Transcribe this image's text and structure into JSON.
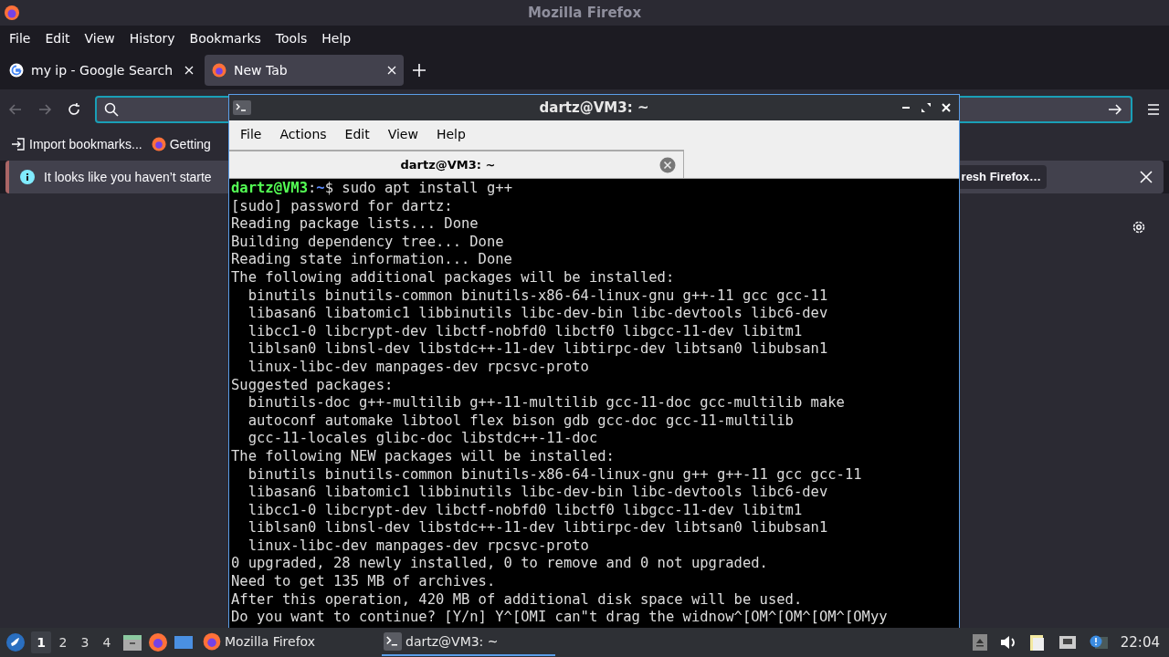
{
  "window": {
    "title": "Mozilla Firefox"
  },
  "menu": [
    "File",
    "Edit",
    "View",
    "History",
    "Bookmarks",
    "Tools",
    "Help"
  ],
  "tabs": [
    {
      "label": "my ip - Google Search",
      "selected": false
    },
    {
      "label": "New Tab",
      "selected": true
    }
  ],
  "bookmarks": [
    "Import bookmarks...",
    "Getting"
  ],
  "notification": {
    "text": "It looks like you haven’t starte",
    "button": "resh Firefox…"
  },
  "terminal": {
    "title": "dartz@VM3: ~",
    "menu": [
      "File",
      "Actions",
      "Edit",
      "View",
      "Help"
    ],
    "tab": "dartz@VM3: ~",
    "prompt": {
      "user": "dartz@VM3",
      "separator": ":",
      "path": "~",
      "command": "$ sudo apt install g++"
    },
    "lines": [
      "[sudo] password for dartz:",
      "Reading package lists... Done",
      "Building dependency tree... Done",
      "Reading state information... Done",
      "The following additional packages will be installed:",
      "  binutils binutils-common binutils-x86-64-linux-gnu g++-11 gcc gcc-11",
      "  libasan6 libatomic1 libbinutils libc-dev-bin libc-devtools libc6-dev",
      "  libcc1-0 libcrypt-dev libctf-nobfd0 libctf0 libgcc-11-dev libitm1",
      "  liblsan0 libnsl-dev libstdc++-11-dev libtirpc-dev libtsan0 libubsan1",
      "  linux-libc-dev manpages-dev rpcsvc-proto",
      "Suggested packages:",
      "  binutils-doc g++-multilib g++-11-multilib gcc-11-doc gcc-multilib make",
      "  autoconf automake libtool flex bison gdb gcc-doc gcc-11-multilib",
      "  gcc-11-locales glibc-doc libstdc++-11-doc",
      "The following NEW packages will be installed:",
      "  binutils binutils-common binutils-x86-64-linux-gnu g++ g++-11 gcc gcc-11",
      "  libasan6 libatomic1 libbinutils libc-dev-bin libc-devtools libc6-dev",
      "  libcc1-0 libcrypt-dev libctf-nobfd0 libctf0 libgcc-11-dev libitm1",
      "  liblsan0 libnsl-dev libstdc++-11-dev libtirpc-dev libtsan0 libubsan1",
      "  linux-libc-dev manpages-dev rpcsvc-proto",
      "0 upgraded, 28 newly installed, 0 to remove and 0 not upgraded.",
      "Need to get 135 MB of archives.",
      "After this operation, 420 MB of additional disk space will be used.",
      "Do you want to continue? [Y/n] Y^[OMI can\"t drag the widnow^[OM^[OM^[OM^[OMyy"
    ]
  },
  "taskbar": {
    "workspaces": [
      {
        "label": "1",
        "selected": true
      },
      {
        "label": "2",
        "selected": false
      },
      {
        "label": "3",
        "selected": false
      },
      {
        "label": "4",
        "selected": false
      }
    ],
    "tasks": [
      {
        "label": "Mozilla Firefox",
        "selected": false
      },
      {
        "label": "dartz@VM3: ~",
        "selected": true
      }
    ],
    "clock": "22:04"
  }
}
